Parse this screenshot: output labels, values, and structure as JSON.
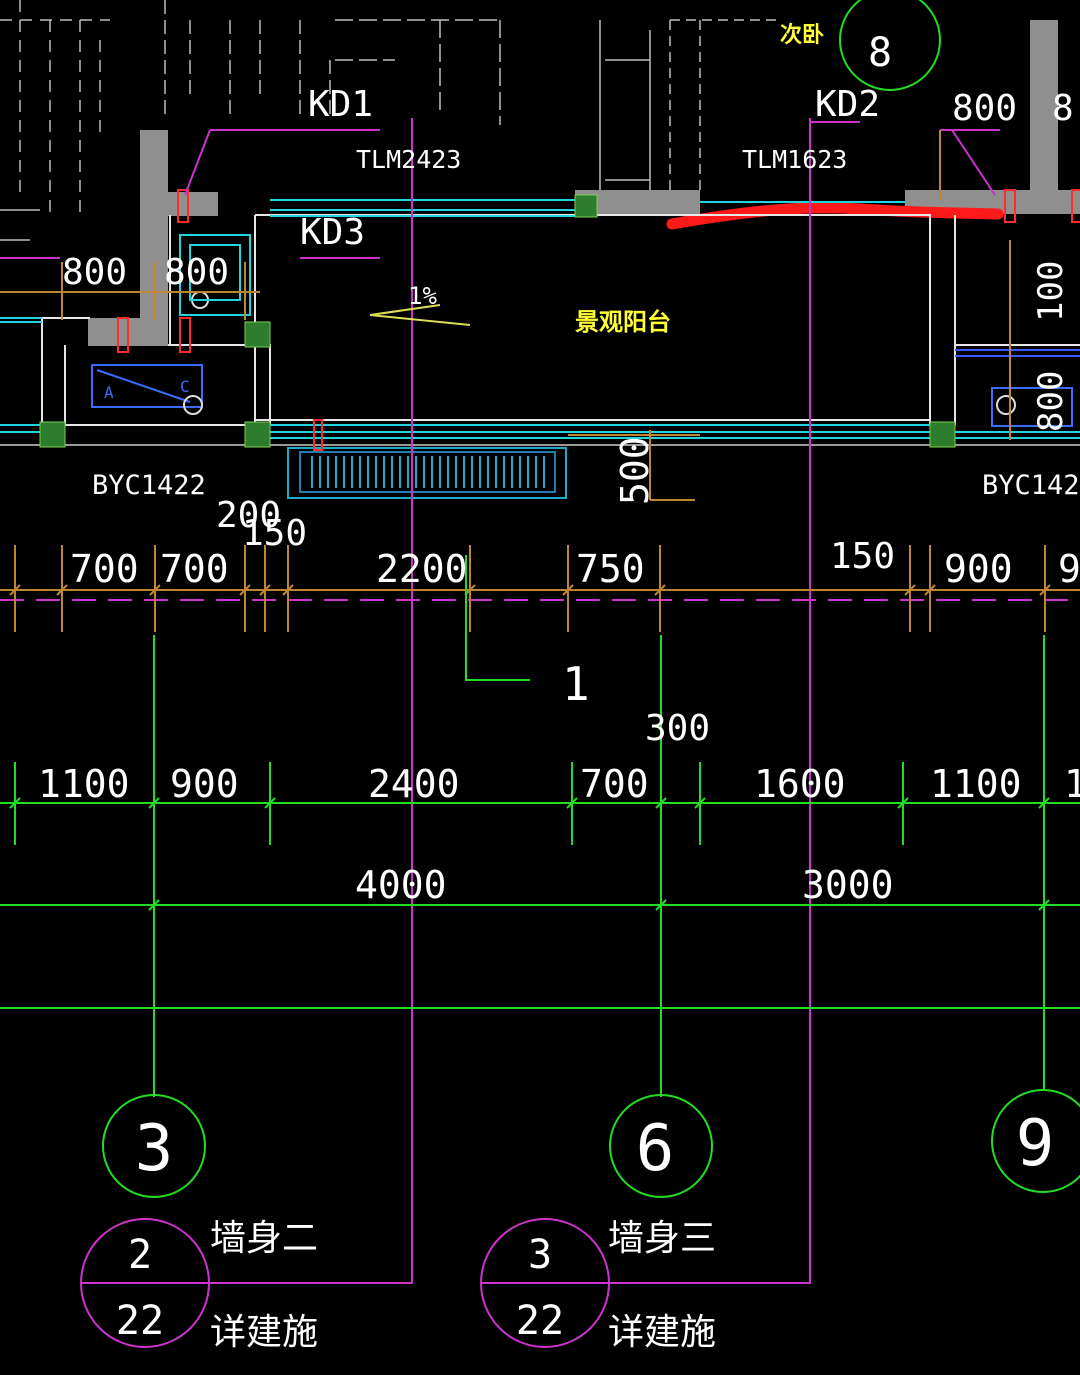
{
  "colors": {
    "background": "#000000",
    "wall": "#8f8f8f",
    "grid_line": "#22dd22",
    "axis_magenta": "#cc33cc",
    "dimension": "#c0862f",
    "cyan": "#22d4e0",
    "text": "#ffffff",
    "yellow_text": "#ffff33",
    "red_mark": "#ff1a1a",
    "column": "#2e7d2e"
  },
  "labels": {
    "kd1": "KD1",
    "kd2": "KD2",
    "kd3": "KD3",
    "tlm2423": "TLM2423",
    "tlm1623": "TLM1623",
    "byc1422": "BYC1422",
    "byc142_partial": "BYC142",
    "slope": "1%",
    "room_second_bed": "次卧",
    "balcony": "景观阳台",
    "section_mark": "1",
    "elevation_marker": "8"
  },
  "dimensions": {
    "top_800_left": "800",
    "top_800_mid": "800",
    "top_800_right": "800",
    "top_8_edge": "8",
    "v_100": "100",
    "v_800": "800",
    "v_500": "500",
    "d_200": "200",
    "d_150_a": "150",
    "d_150_b": "150",
    "d_300": "300",
    "row1": [
      "700",
      "700",
      "2200",
      "750",
      "900",
      "9"
    ],
    "row2": [
      "1100",
      "900",
      "2400",
      "700",
      "1600",
      "1100",
      "1"
    ],
    "row3": [
      "4000",
      "3000"
    ]
  },
  "axes": [
    {
      "label": "3"
    },
    {
      "label": "6"
    },
    {
      "label": "9"
    }
  ],
  "callouts": [
    {
      "top": "2",
      "bottom": "22",
      "title": "墙身二",
      "note": "详建施"
    },
    {
      "top": "3",
      "bottom": "22",
      "title": "墙身三",
      "note": "详建施"
    }
  ]
}
